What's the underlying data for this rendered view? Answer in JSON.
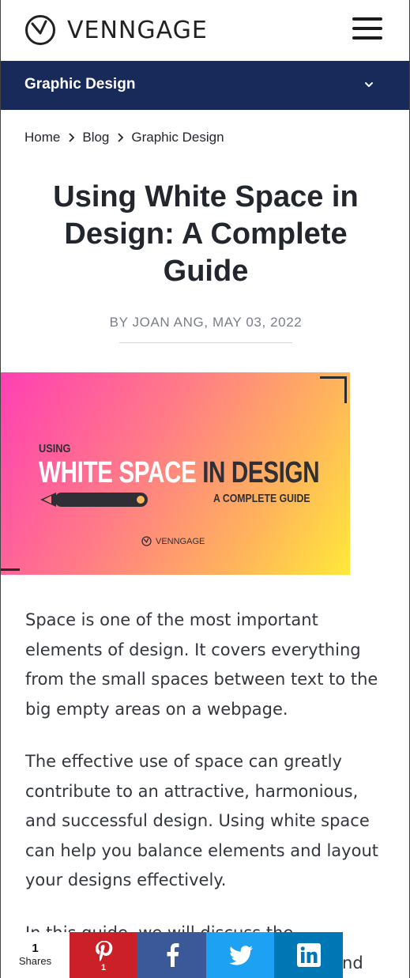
{
  "header": {
    "brand": "VENNGAGE",
    "logo_icon": "venngage-logo-icon",
    "menu_icon": "hamburger-menu-icon"
  },
  "category_bar": {
    "label": "Graphic Design",
    "icon": "chevron-down-icon"
  },
  "breadcrumb": [
    "Home",
    "Blog",
    "Graphic Design"
  ],
  "article": {
    "title": "Using White Space in Design: A Complete Guide",
    "byline": "BY JOAN ANG, MAY 03, 2022",
    "hero": {
      "kicker": "USING",
      "headline_white": "WHITE SPACE",
      "headline_dark": " IN DESIGN",
      "subtitle": "A COMPLETE GUIDE",
      "brand": "VENNGAGE"
    },
    "paragraphs": [
      "Space is one of the most important elements of design. It covers everything from the small spaces between text to the big empty areas on a webpage.",
      "The effective use of space can greatly contribute to an attractive, harmonious, and successful design. Using white space can help you balance elements and layout your designs effectively.",
      "In this guide, we will discuss the importance of white space in design and how to use it in your"
    ]
  },
  "share_bar": {
    "count": "1",
    "label": "Shares",
    "pinterest_count": "1",
    "colors": {
      "pinterest": "#cb2027",
      "facebook": "#3b5998",
      "twitter": "#1da1f2",
      "linkedin": "#0077b5"
    }
  },
  "colors": {
    "nav_background": "#172a5a",
    "text": "#23262d",
    "byline": "#7b7e85"
  }
}
